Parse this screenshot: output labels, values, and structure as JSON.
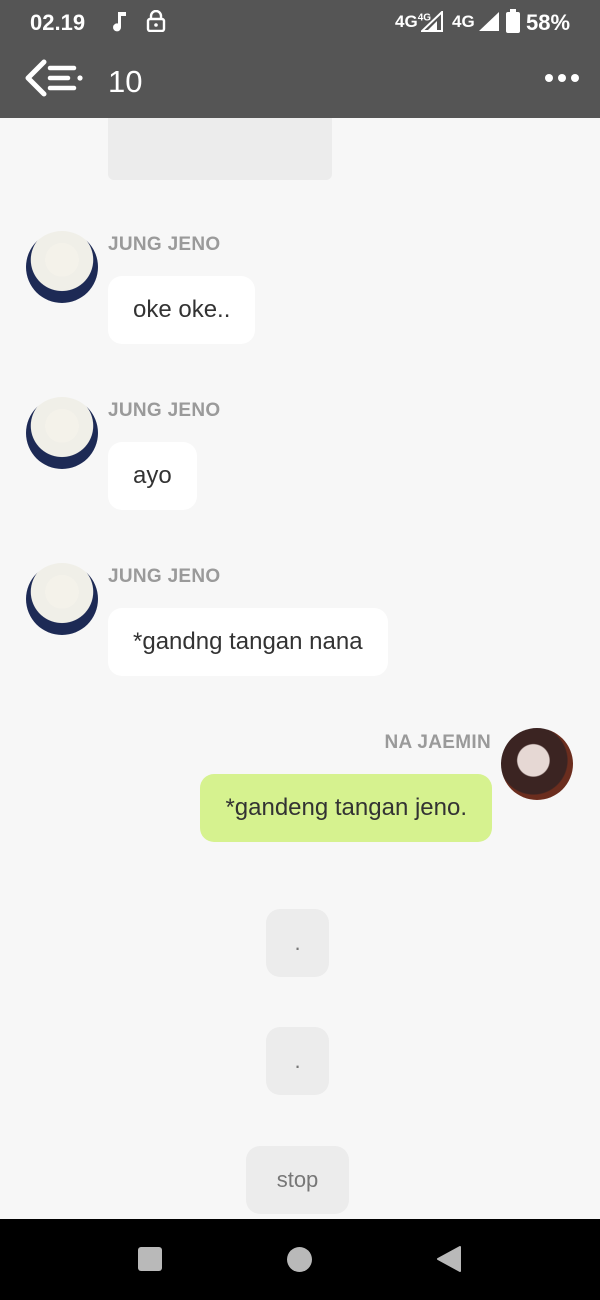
{
  "status_bar": {
    "time": "02.19",
    "net1": "4G",
    "net1_sup": "4G",
    "net2": "4G",
    "battery": "58%"
  },
  "app_bar": {
    "title": "10"
  },
  "messages": [
    {
      "sender": "JUNG JENO",
      "text": "oke oke..",
      "side": "left"
    },
    {
      "sender": "JUNG JENO",
      "text": "ayo",
      "side": "left"
    },
    {
      "sender": "JUNG JENO",
      "text": "*gandng tangan nana",
      "side": "left"
    },
    {
      "sender": "NA JAEMIN",
      "text": "*gandeng tangan jeno.",
      "side": "right"
    }
  ],
  "system_messages": [
    {
      "text": "."
    },
    {
      "text": "."
    },
    {
      "text": "stop"
    }
  ],
  "colors": {
    "bar": "#555555",
    "background": "#f7f7f7",
    "outgoing_bubble": "#d6f28f",
    "incoming_bubble": "#ffffff"
  },
  "icons": [
    "music-note-icon",
    "lock-icon",
    "signal-icon",
    "battery-icon",
    "back-menu-icon",
    "more-dots-icon",
    "recents-icon",
    "home-icon",
    "back-triangle-icon"
  ]
}
